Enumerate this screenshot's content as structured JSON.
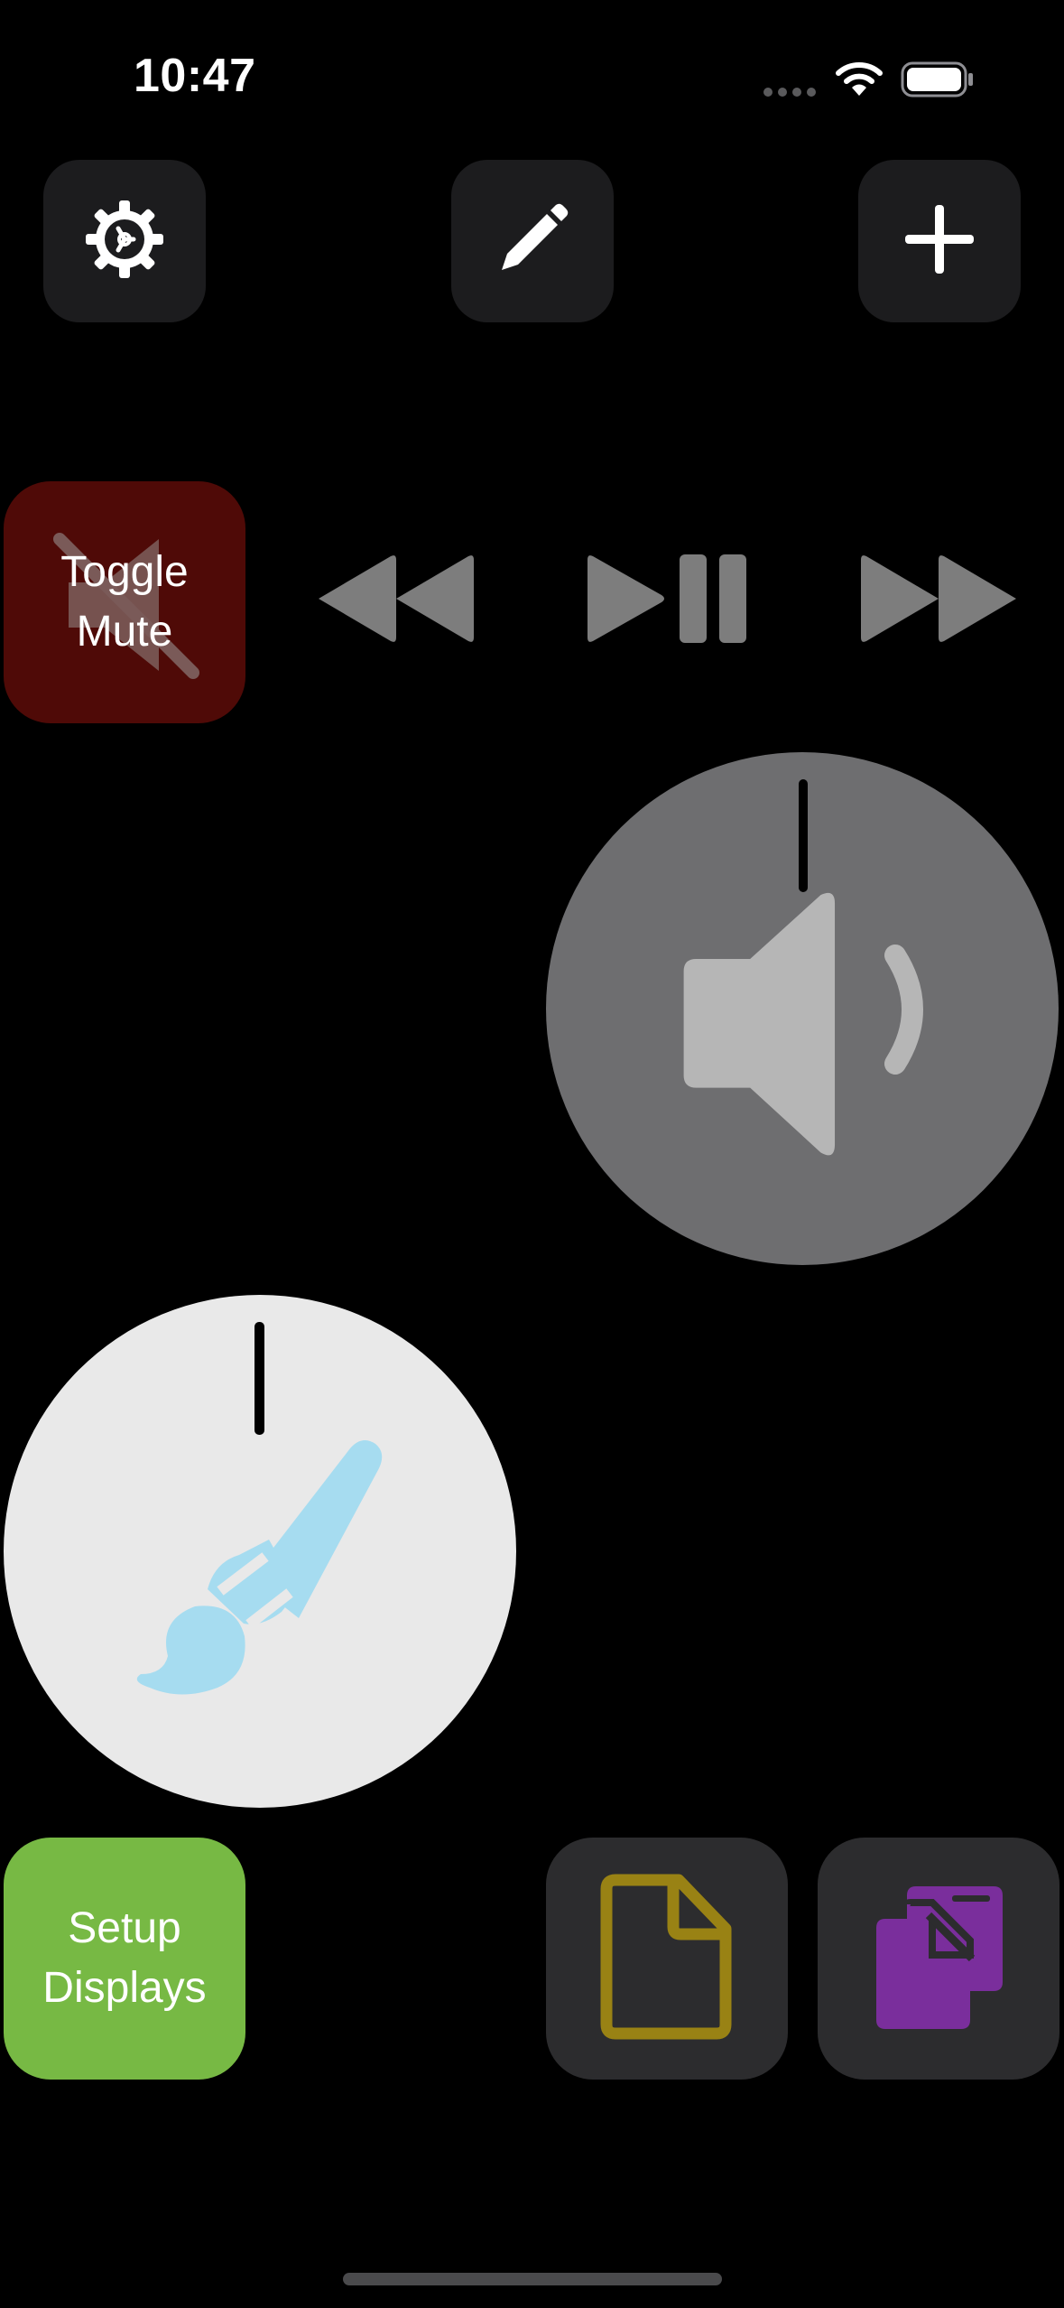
{
  "status_bar": {
    "time": "10:47"
  },
  "toolbar": {
    "settings_icon": "gear-icon",
    "edit_icon": "pencil-icon",
    "add_icon": "plus-icon"
  },
  "tiles": {
    "toggle_mute": {
      "label": "Toggle\nMute",
      "icon": "speaker-slash-icon",
      "color": "#4f0a07"
    },
    "setup_displays": {
      "label": "Setup\nDisplays",
      "color": "#77b944"
    },
    "new_document": {
      "icon": "document-icon",
      "color": "#998214"
    },
    "duplicate_document": {
      "icon": "documents-copy-icon",
      "color": "#7a2e9c"
    }
  },
  "media_controls": {
    "rewind_icon": "backward-icon",
    "play_pause_icon": "play-pause-icon",
    "forward_icon": "forward-icon"
  },
  "knobs": {
    "volume": {
      "icon": "speaker-icon",
      "color": "#6e6e70"
    },
    "brush": {
      "icon": "paintbrush-icon",
      "color": "#e9e9e9",
      "icon_color": "#a6dcf0"
    }
  }
}
